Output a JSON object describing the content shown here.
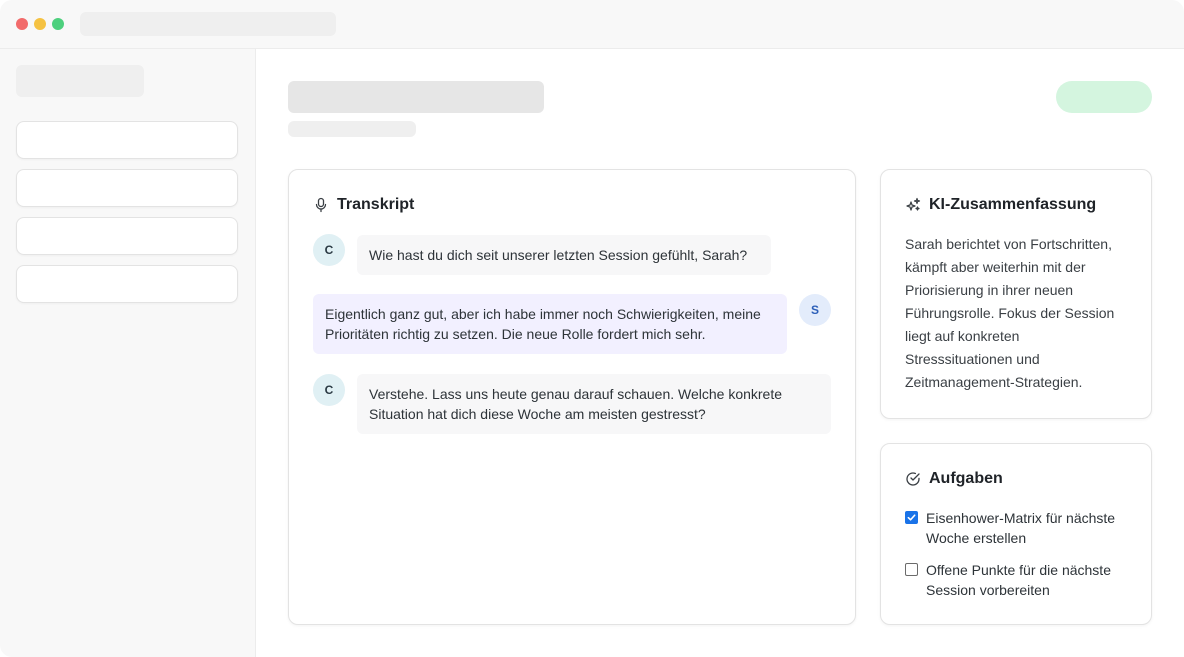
{
  "transcript": {
    "title": "Transkript",
    "icon": "microphone-icon",
    "messages": [
      {
        "speaker": "C",
        "role": "coach",
        "text": "Wie hast du dich seit unserer letzten Session gefühlt, Sarah?"
      },
      {
        "speaker": "S",
        "role": "client",
        "text": "Eigentlich ganz gut, aber ich habe immer noch Schwierigkeiten, meine Prioritäten richtig zu setzen. Die neue Rolle fordert mich sehr."
      },
      {
        "speaker": "C",
        "role": "coach",
        "text": "Verstehe. Lass uns heute genau darauf schauen. Welche konkrete Situation hat dich diese Woche am meisten gestresst?"
      }
    ]
  },
  "summary": {
    "title": "KI-Zusammenfassung",
    "icon": "sparkles-icon",
    "text": "Sarah berichtet von Fortschritten, kämpft aber weiterhin mit der Priorisierung in ihrer neuen Führungsrolle. Fokus der Session liegt auf konkreten Stresssituationen und Zeitmanagement-Strategien."
  },
  "tasks": {
    "title": "Aufgaben",
    "icon": "check-circle-icon",
    "items": [
      {
        "label": "Eisenhower-Matrix für nächste Woche erstellen",
        "checked": true
      },
      {
        "label": "Offene Punkte für die nächste Session vorbereiten",
        "checked": false
      }
    ]
  },
  "colors": {
    "accent": "#1a73e8",
    "client_bubble": "#f2f0ff",
    "coach_bubble": "#f7f7f8",
    "status_placeholder": "#d4f5df"
  }
}
